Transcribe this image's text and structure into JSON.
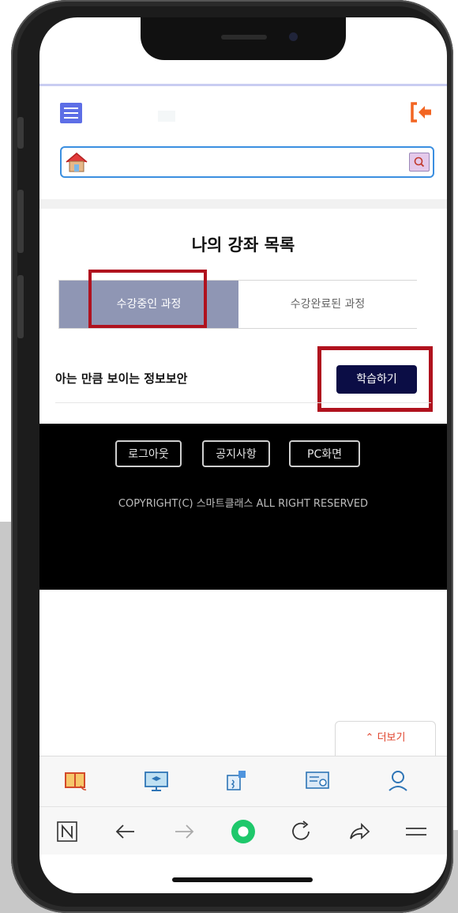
{
  "header": {
    "menu_icon": "hamburger-icon",
    "logout_icon": "logout-icon"
  },
  "search": {
    "home_icon": "home-icon",
    "search_icon": "search-icon",
    "value": ""
  },
  "main": {
    "title": "나의 강좌 목록",
    "tabs": [
      {
        "label": "수강중인 과정",
        "active": true
      },
      {
        "label": "수강완료된 과정",
        "active": false
      }
    ],
    "course": {
      "title": "아는 만큼 보이는 정보보안",
      "action_label": "학습하기"
    }
  },
  "footer": {
    "buttons": [
      "로그아웃",
      "공지사항",
      "PC화면"
    ],
    "copyright": "COPYRIGHT(C) 스마트클래스 ALL RIGHT RESERVED"
  },
  "more": {
    "label": "더보기",
    "icon": "chevron-up-icon"
  },
  "quickbar": {
    "icons": [
      "book-icon",
      "monitor-graduation-icon",
      "puzzle-icon",
      "certificate-icon",
      "user-icon"
    ]
  },
  "browser_nav": {
    "icons": [
      "naver-icon",
      "back-arrow-icon",
      "forward-arrow-icon",
      "home-circle-icon",
      "refresh-icon",
      "share-icon",
      "menu-icon"
    ]
  },
  "colors": {
    "accent": "#5d6ee6",
    "tab_active": "#8f96b4",
    "study_button": "#0b0d45",
    "highlight": "#b0121e",
    "logout": "#f26522",
    "more": "#e0452e"
  }
}
